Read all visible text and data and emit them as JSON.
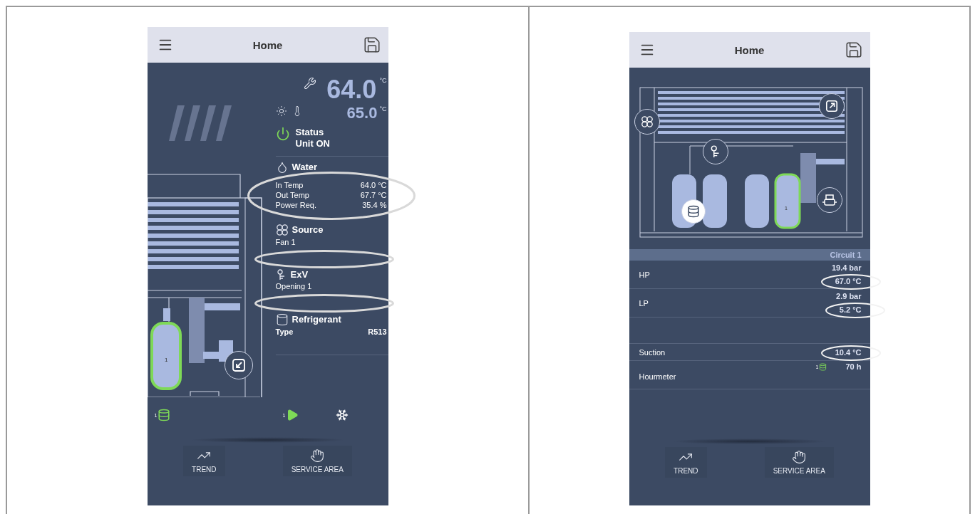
{
  "panels": [
    {
      "kind": "status",
      "header": {
        "title": "Home"
      },
      "drawing": {
        "compressor_label": "1"
      },
      "readings": {
        "setpoint": "64.0",
        "setpoint_unit": "°C",
        "ambient": "65.0",
        "ambient_unit": "°C"
      },
      "status": {
        "label": "Status",
        "value": "Unit ON",
        "on": true
      },
      "sections": [
        {
          "kind": "water",
          "title": "Water",
          "circled": true,
          "rows": [
            {
              "label": "In Temp",
              "value": "64.0 °C"
            },
            {
              "label": "Out Temp",
              "value": "67.7 °C"
            },
            {
              "label": "Power Req.",
              "value": "35.4 %"
            }
          ]
        },
        {
          "kind": "source",
          "title": "Source",
          "circled": true,
          "rows": [
            {
              "label": "Fan 1"
            }
          ]
        },
        {
          "kind": "exv",
          "title": "ExV",
          "circled": true,
          "rows": [
            {
              "label": "Opening 1"
            }
          ]
        },
        {
          "kind": "refrigerant",
          "title": "Refrigerant",
          "rows": [
            {
              "label": "Type",
              "value": "R513"
            }
          ]
        }
      ],
      "components": [
        {
          "kind": "compressor",
          "number": "1",
          "active": true
        },
        {
          "kind": "pump",
          "number": "1",
          "active": true
        },
        {
          "kind": "defrost",
          "active": false
        }
      ],
      "nav": [
        {
          "kind": "trend",
          "label": "TREND"
        },
        {
          "kind": "service",
          "label": "SERVICE AREA"
        }
      ]
    },
    {
      "kind": "circuit",
      "header": {
        "title": "Home"
      },
      "drawing": {
        "compressor_label": "1"
      },
      "table": {
        "column": "Circuit 1",
        "rows": [
          {
            "kind": "values",
            "label": "HP",
            "values": [
              {
                "text": "19.4 bar",
                "circled": false
              },
              {
                "text": "67.0 °C",
                "circled": true
              }
            ]
          },
          {
            "kind": "values",
            "label": "LP",
            "values": [
              {
                "text": "2.9 bar",
                "circled": false
              },
              {
                "text": "5.2 °C",
                "circled": true
              }
            ]
          },
          {
            "kind": "values",
            "label": "Suction",
            "values": [
              {
                "text": "10.4 °C",
                "circled": true
              }
            ]
          },
          {
            "kind": "hourmeter",
            "label": "Hourmeter",
            "compressor_number": "1",
            "values": [
              {
                "text": "70 h",
                "circled": false
              }
            ]
          }
        ]
      },
      "nav": [
        {
          "kind": "trend",
          "label": "TREND"
        },
        {
          "kind": "service",
          "label": "SERVICE AREA"
        }
      ]
    }
  ]
}
